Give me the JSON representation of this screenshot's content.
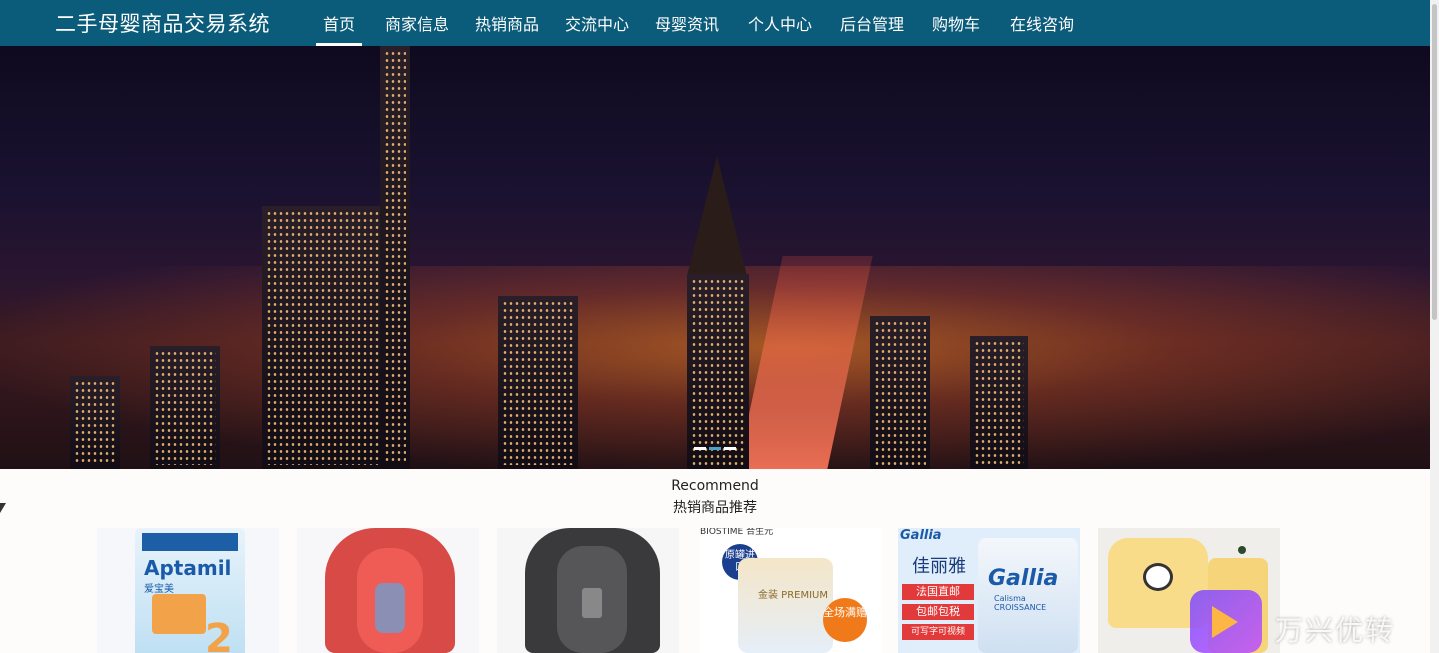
{
  "header": {
    "brand": "二手母婴商品交易系统",
    "nav": [
      {
        "label": "首页",
        "active": true
      },
      {
        "label": "商家信息"
      },
      {
        "label": "热销商品"
      },
      {
        "label": "交流中心"
      },
      {
        "label": "母婴资讯"
      },
      {
        "label": "个人中心"
      },
      {
        "label": "后台管理"
      },
      {
        "label": "购物车"
      },
      {
        "label": "在线咨询"
      }
    ],
    "bg_color": "#0b5b7a"
  },
  "banner": {
    "image": "night-city-skyline",
    "slides": 3,
    "active_slide": 1
  },
  "recommend": {
    "title_en": "Recommend",
    "title_cn": "热销商品推荐",
    "products": [
      {
        "image": "aptamil-formula-can",
        "brand": "Aptamil",
        "label": "爱宝美",
        "badge": "2"
      },
      {
        "image": "red-child-car-seat"
      },
      {
        "image": "grey-child-car-seat"
      },
      {
        "image": "biostime-formula-can",
        "brand": "BIOSTIME 合生元",
        "label": "金装 PREMIUM",
        "tag_top": "原罐进口",
        "tag_promo": "全场满赠"
      },
      {
        "image": "gallia-formula-can",
        "brand": "Gallia",
        "label": "佳丽雅",
        "sub": "Calisma CROISSANCE",
        "tags": [
          "法国直邮",
          "包邮包税",
          "可写字可视频"
        ]
      },
      {
        "image": "yellow-baby-clothes-panda"
      }
    ]
  },
  "watermark": {
    "text": "万兴优转",
    "icon": "play-logo-icon"
  }
}
